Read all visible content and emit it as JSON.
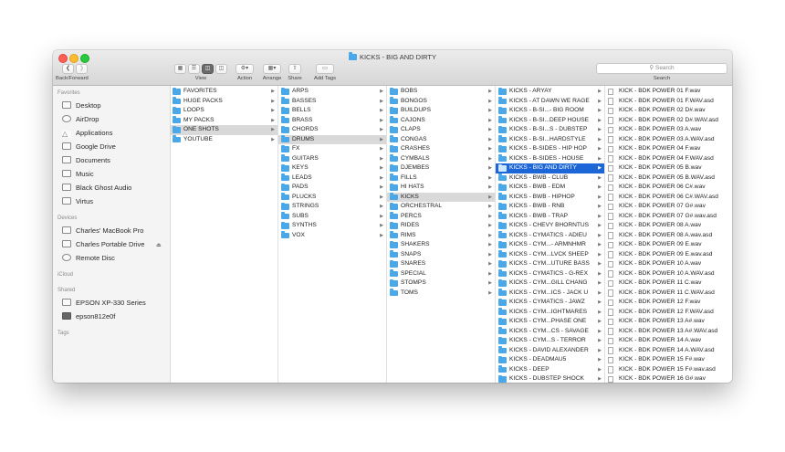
{
  "window_title": "KICKS - BIG AND DIRTY",
  "toolbar": {
    "back_forward_label": "Back/Forward",
    "view_label": "View",
    "action_label": "Action",
    "arrange_label": "Arrange",
    "share_label": "Share",
    "add_tags_label": "Add Tags",
    "search_label": "Search",
    "search_placeholder": "Search"
  },
  "sidebar": {
    "favorites_heading": "Favorites",
    "favorites": [
      "Desktop",
      "AirDrop",
      "Applications",
      "Google Drive",
      "Documents",
      "Music",
      "Black Ghost Audio",
      "Virtus"
    ],
    "devices_heading": "Devices",
    "devices": [
      "Charles' MacBook Pro",
      "Charles Portable Drive",
      "Remote Disc"
    ],
    "icloud_heading": "iCloud",
    "shared_heading": "Shared",
    "shared": [
      "EPSON XP-330 Series",
      "epson812e0f"
    ],
    "tags_heading": "Tags"
  },
  "columns": [
    {
      "items": [
        "FAVORITES",
        "HUGE PACKS",
        "LOOPS",
        "MY PACKS",
        "ONE SHOTS",
        "YOUTUBE"
      ],
      "selected": 4
    },
    {
      "items": [
        "ARPS",
        "BASSES",
        "BELLS",
        "BRASS",
        "CHORDS",
        "DRUMS",
        "FX",
        "GUITARS",
        "KEYS",
        "LEADS",
        "PADS",
        "PLUCKS",
        "STRINGS",
        "SUBS",
        "SYNTHS",
        "VOX"
      ],
      "selected": 5
    },
    {
      "items": [
        "BOBS",
        "BONGOS",
        "BUILDUPS",
        "CAJONS",
        "CLAPS",
        "CONGAS",
        "CRASHES",
        "CYMBALS",
        "DJEMBES",
        "FILLS",
        "HI HATS",
        "KICKS",
        "ORCHESTRAL",
        "PERCS",
        "RIDES",
        "RIMS",
        "SHAKERS",
        "SNAPS",
        "SNARES",
        "SPECIAL",
        "STOMPS",
        "TOMS"
      ],
      "selected": 11
    },
    {
      "items": [
        "KICKS - ARYAY",
        "KICKS - AT DAWN WE RAGE",
        "KICKS - B-SI...- BIG ROOM",
        "KICKS - B-SI...DEEP HOUSE",
        "KICKS - B-SI...S - DUBSTEP",
        "KICKS - B-SI...HARDSTYLE",
        "KICKS - B-SIDES - HIP HOP",
        "KICKS - B-SIDES - HOUSE",
        "KICKS - BIG AND DIRTY",
        "KICKS - BWB - CLUB",
        "KICKS - BWB - EDM",
        "KICKS - BWB - HIPHOP",
        "KICKS - BWB - RNB",
        "KICKS - BWB - TRAP",
        "KICKS - CHEVY BHORNTUS",
        "KICKS - CYMATICS - ADIEU",
        "KICKS - CYM...- ARMNHMR",
        "KICKS - CYM...LVCK SHEEP",
        "KICKS - CYM...UTURE BASS",
        "KICKS - CYMATICS - G-REX",
        "KICKS - CYM...GILL CHANG",
        "KICKS - CYM...ICS - JACK U",
        "KICKS - CYMATICS - JAWZ",
        "KICKS - CYM...IGHTMARES",
        "KICKS - CYM...PHASE ONE",
        "KICKS - CYM...CS - SAVAGE",
        "KICKS - CYM...S - TERROR",
        "KICKS - DAVID ALEXANDER",
        "KICKS - DEADMAU5",
        "KICKS - DEEP",
        "KICKS - DUBSTEP SHOCK"
      ],
      "selected": 8
    },
    {
      "items": [
        "KICK - BDK POWER 01 F.wav",
        "KICK - BDK POWER 01 F.WAV.asd",
        "KICK - BDK POWER 02 D#.wav",
        "KICK - BDK POWER 02 D#.WAV.asd",
        "KICK - BDK POWER 03 A.wav",
        "KICK - BDK POWER 03 A.WAV.asd",
        "KICK - BDK POWER 04 F.wav",
        "KICK - BDK POWER 04 F.WAV.asd",
        "KICK - BDK POWER 05 B.wav",
        "KICK - BDK POWER 05 B.WAV.asd",
        "KICK - BDK POWER 06 C#.wav",
        "KICK - BDK POWER 06 C#.WAV.asd",
        "KICK - BDK POWER 07 G#.wav",
        "KICK - BDK POWER 07 G#.wav.asd",
        "KICK - BDK POWER 08 A.wav",
        "KICK - BDK POWER 08 A.wav.asd",
        "KICK - BDK POWER 09 E.wav",
        "KICK - BDK POWER 09 E.wav.asd",
        "KICK - BDK POWER 10 A.wav",
        "KICK - BDK POWER 10 A.WAV.asd",
        "KICK - BDK POWER 11 C.wav",
        "KICK - BDK POWER 11 C.WAV.asd",
        "KICK - BDK POWER 12 F.wav",
        "KICK - BDK POWER 12 F.WAV.asd",
        "KICK - BDK POWER 13 A#.wav",
        "KICK - BDK POWER 13 A#.WAV.asd",
        "KICK - BDK POWER 14 A.wav",
        "KICK - BDK POWER 14 A.WAV.asd",
        "KICK - BDK POWER 15 F#.wav",
        "KICK - BDK POWER 15 F#.wav.asd",
        "KICK - BDK POWER 16 G#.wav"
      ],
      "selected": -1
    }
  ],
  "colors": {
    "selection_active": "#1d66d7",
    "selection_inactive": "#d9d9d9",
    "folder": "#4aa8e8"
  }
}
